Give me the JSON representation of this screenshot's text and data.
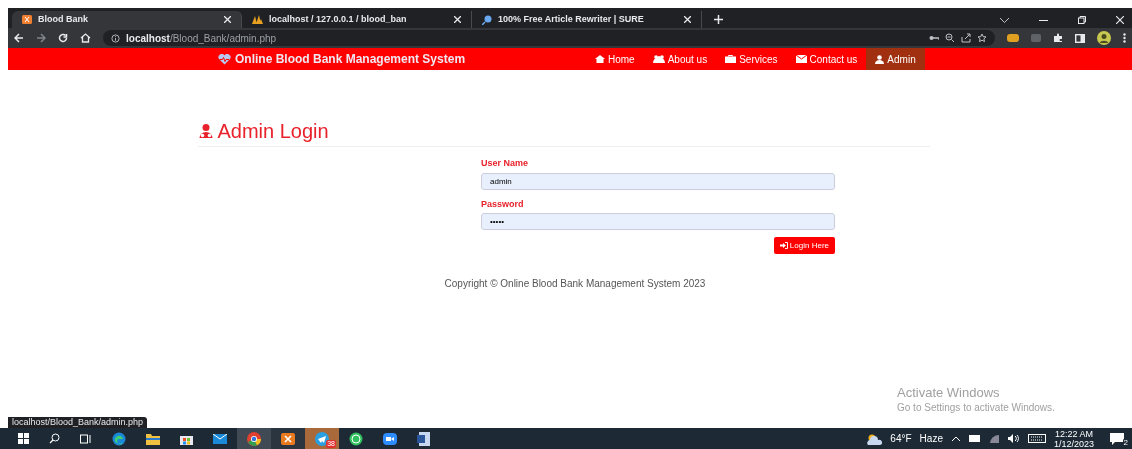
{
  "browser": {
    "tabs": [
      {
        "title": "Blood Bank",
        "selected": true
      },
      {
        "title": "localhost / 127.0.0.1 / blood_ban",
        "selected": false
      },
      {
        "title": "100% Free Article Rewriter | SURE",
        "selected": false
      }
    ],
    "url_host": "localhost",
    "url_path": "/Blood_Bank/admin.php"
  },
  "navbar": {
    "brand": "Online Blood Bank Management System",
    "items": [
      {
        "label": "Home",
        "selected": false
      },
      {
        "label": "About us",
        "selected": false
      },
      {
        "label": "Services",
        "selected": false
      },
      {
        "label": "Contact us",
        "selected": false
      },
      {
        "label": "Admin",
        "selected": true
      }
    ]
  },
  "heading": "Admin Login",
  "form": {
    "fields": [
      {
        "label": "User Name",
        "value": "admin",
        "kind": "text"
      },
      {
        "label": "Password",
        "value": "•••••",
        "kind": "password"
      }
    ],
    "button": "Login Here"
  },
  "footer": "Copyright © Online Blood Bank Management System 2023",
  "status_url": "localhost/Blood_Bank/admin.php",
  "watermark": {
    "title": "Activate Windows",
    "subtitle": "Go to Settings to activate Windows."
  },
  "taskbar": {
    "telegram_badge": "38",
    "temperature": "64°F",
    "weather": "Haze",
    "time": "12:22 AM",
    "date": "1/12/2023",
    "notifications": "2"
  }
}
